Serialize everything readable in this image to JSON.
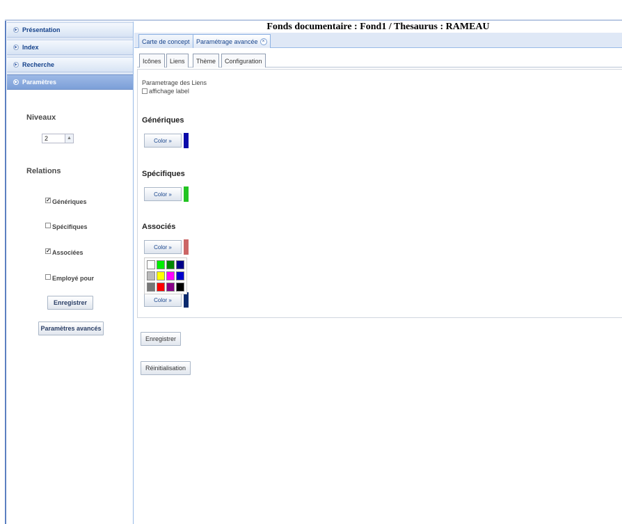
{
  "window": {
    "title": "Fonds documentaire : Fond1 / Thesaurus : RAMEAU"
  },
  "sidebar": {
    "items": [
      {
        "label": "Présentation"
      },
      {
        "label": "Index"
      },
      {
        "label": "Recherche"
      },
      {
        "label": "Paramètres"
      }
    ],
    "niveaux_label": "Niveaux",
    "niveaux_value": "2",
    "relations_label": "Relations",
    "relations": [
      {
        "label": "Génériques",
        "checked": true
      },
      {
        "label": "Spécifiques",
        "checked": false
      },
      {
        "label": "Associées",
        "checked": true
      },
      {
        "label": "Employé pour",
        "checked": false
      }
    ],
    "save_button": "Enregistrer",
    "advanced_button": "Paramètres avancés"
  },
  "tabs": [
    {
      "label": "Carte de concept"
    },
    {
      "label": "Paramétrage avancée"
    }
  ],
  "subtabs": [
    {
      "label": "Icônes"
    },
    {
      "label": "Liens"
    },
    {
      "label": "Thème"
    },
    {
      "label": "Configuration"
    }
  ],
  "content": {
    "heading": "Parametrage des Liens",
    "affichage_label": "affichage label",
    "sections": [
      {
        "title": "Génériques",
        "button": "Color »",
        "color": "#0a0aaa"
      },
      {
        "title": "Spécifiques",
        "button": "Color »",
        "color": "#22c422"
      },
      {
        "title": "Associés",
        "button": "Color »",
        "color": "#cc6666"
      }
    ],
    "hidden_button": "Color »",
    "hidden_color": "#0a2a6e",
    "palette": [
      "#ffffff",
      "#00ee00",
      "#008800",
      "#000088",
      "#bbbbbb",
      "#ffff00",
      "#ff00ff",
      "#0000cc",
      "#777777",
      "#ff0000",
      "#880088",
      "#000000"
    ]
  },
  "footer": {
    "save_button": "Enregistrer",
    "reset_button": "Réinitialisation"
  },
  "colors": {
    "accent": "#15428b",
    "sidebar_bg": "#dfe8f6",
    "active": "#7c9fd8"
  }
}
